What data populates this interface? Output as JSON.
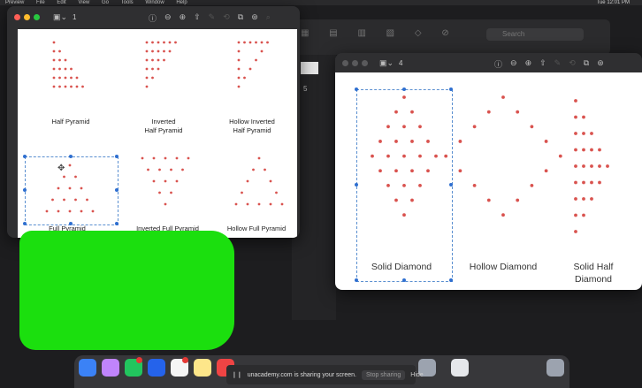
{
  "menubar": {
    "items": [
      "Preview",
      "File",
      "Edit",
      "View",
      "Go",
      "Tools",
      "Window",
      "Help"
    ],
    "status": "Tue 12:01 PM"
  },
  "background_window": {
    "search_placeholder": "Search",
    "sidebar_number": "5"
  },
  "window1": {
    "page_number": "1",
    "patterns": [
      {
        "label": "Half Pyramid",
        "shape": "half-pyramid"
      },
      {
        "label": "Inverted\nHalf Pyramid",
        "shape": "inverted-half-pyramid"
      },
      {
        "label": "Hollow Inverted\nHalf Pyramid",
        "shape": "hollow-inverted-half-pyramid"
      },
      {
        "label": "Full Pyramid",
        "shape": "full-pyramid",
        "selected": true
      },
      {
        "label": "Inverted Full Pyramid",
        "shape": "inverted-full-pyramid"
      },
      {
        "label": "Hollow Full Pyramid",
        "shape": "hollow-full-pyramid"
      }
    ]
  },
  "window2": {
    "page_number": "4",
    "patterns": [
      {
        "label": "Solid Diamond",
        "shape": "solid-diamond",
        "selected": true
      },
      {
        "label": "Hollow Diamond",
        "shape": "hollow-diamond"
      },
      {
        "label": "Solid Half\nDiamond",
        "shape": "solid-half-diamond"
      }
    ]
  },
  "star_color": "#d9534f",
  "accent": "#2f6fd0",
  "redaction_color": "#1bdf0e",
  "dock": {
    "share_text": "unacademy.com is sharing your screen.",
    "stop_label": "Stop sharing",
    "hide_label": "Hide",
    "mail_badge": "1",
    "reminders_badge": "6"
  }
}
